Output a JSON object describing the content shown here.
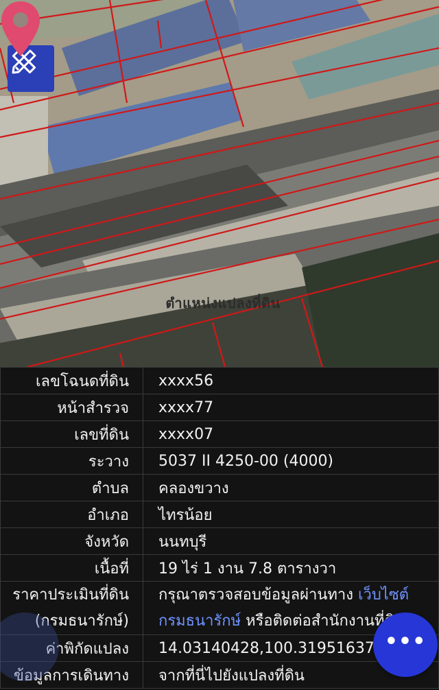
{
  "map": {
    "pin_label": "ตำแหน่งแปลงที่ดิน",
    "tool_icon": "ruler-pencil-icon",
    "accent_color": "#2b3fb6",
    "pin_color": "#e04a6e",
    "boundary_color": "#d01818"
  },
  "rows": [
    {
      "label": "เลขโฉนดที่ดิน",
      "value": "xxxx56"
    },
    {
      "label": "หน้าสำรวจ",
      "value": "xxxx77"
    },
    {
      "label": "เลขที่ดิน",
      "value": "xxxx07"
    },
    {
      "label": "ระวาง",
      "value": "5037 II 4250-00 (4000)"
    },
    {
      "label": "ตำบล",
      "value": "คลองขวาง"
    },
    {
      "label": "อำเภอ",
      "value": "ไทรน้อย"
    },
    {
      "label": "จังหวัด",
      "value": "นนทบุรี"
    },
    {
      "label": "เนื้อที่",
      "value": "19 ไร่ 1 งาน 7.8 ตารางวา"
    }
  ],
  "appraisal": {
    "label_line1": "ราคาประเมินที่ดิน",
    "label_line2": "(กรมธนารักษ์)",
    "text1": "กรุณาตรวจสอบข้อมูลผ่านทาง ",
    "link1": "เว็บไซต์",
    "link2": "กรมธนารักษ์",
    "text2": " หรือติดต่อสำนักงานที่ดิน"
  },
  "coords": {
    "label": "ค่าพิกัดแปลง",
    "value": "14.03140428,100.31951637"
  },
  "directions": {
    "label": "ข้อมูลการเดินทาง",
    "value": "จากที่นี่ไปยังแปลงที่ดิน"
  },
  "fab": {
    "label": "•••",
    "icon": "more-icon",
    "color": "#2736d6"
  }
}
